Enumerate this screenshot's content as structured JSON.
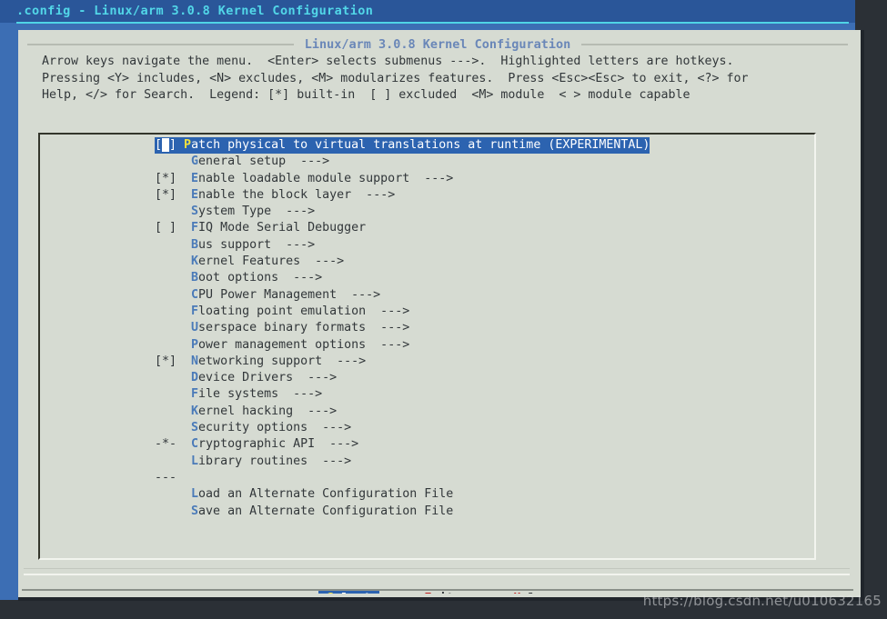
{
  "window": {
    "titlebar_text": ".config - Linux/arm 3.0.8 Kernel Configuration"
  },
  "dialog": {
    "title": "Linux/arm 3.0.8 Kernel Configuration",
    "help_lines": [
      "Arrow keys navigate the menu.  <Enter> selects submenus --->.  Highlighted letters are hotkeys.",
      "Pressing <Y> includes, <N> excludes, <M> modularizes features.  Press <Esc><Esc> to exit, <?> for",
      "Help, </> for Search.  Legend: [*] built-in  [ ] excluded  <M> module  < > module capable"
    ]
  },
  "menu": {
    "items": [
      {
        "mark": "[ ]",
        "hot": "P",
        "rest": "atch physical to virtual translations at runtime (EXPERIMENTAL)",
        "arrow": "",
        "selected": true
      },
      {
        "mark": "",
        "hot": "G",
        "rest": "eneral setup",
        "arrow": "  --->",
        "selected": false
      },
      {
        "mark": "[*]",
        "hot": "E",
        "rest": "nable loadable module support",
        "arrow": "  --->",
        "selected": false
      },
      {
        "mark": "[*]",
        "hot": "E",
        "rest": "nable the block layer",
        "arrow": "  --->",
        "selected": false
      },
      {
        "mark": "",
        "hot": "S",
        "rest": "ystem Type",
        "arrow": "  --->",
        "selected": false
      },
      {
        "mark": "[ ]",
        "hot": "F",
        "rest": "IQ Mode Serial Debugger",
        "arrow": "",
        "selected": false
      },
      {
        "mark": "",
        "hot": "B",
        "rest": "us support",
        "arrow": "  --->",
        "selected": false
      },
      {
        "mark": "",
        "hot": "K",
        "rest": "ernel Features",
        "arrow": "  --->",
        "selected": false
      },
      {
        "mark": "",
        "hot": "B",
        "rest": "oot options",
        "arrow": "  --->",
        "selected": false
      },
      {
        "mark": "",
        "hot": "C",
        "rest": "PU Power Management",
        "arrow": "  --->",
        "selected": false
      },
      {
        "mark": "",
        "hot": "F",
        "rest": "loating point emulation",
        "arrow": "  --->",
        "selected": false
      },
      {
        "mark": "",
        "hot": "U",
        "rest": "serspace binary formats",
        "arrow": "  --->",
        "selected": false
      },
      {
        "mark": "",
        "hot": "P",
        "rest": "ower management options",
        "arrow": "  --->",
        "selected": false
      },
      {
        "mark": "[*]",
        "hot": "N",
        "rest": "etworking support",
        "arrow": "  --->",
        "selected": false
      },
      {
        "mark": "",
        "hot": "D",
        "rest": "evice Drivers",
        "arrow": "  --->",
        "selected": false
      },
      {
        "mark": "",
        "hot": "F",
        "rest": "ile systems",
        "arrow": "  --->",
        "selected": false
      },
      {
        "mark": "",
        "hot": "K",
        "rest": "ernel hacking",
        "arrow": "  --->",
        "selected": false
      },
      {
        "mark": "",
        "hot": "S",
        "rest": "ecurity options",
        "arrow": "  --->",
        "selected": false
      },
      {
        "mark": "-*-",
        "hot": "C",
        "rest": "ryptographic API",
        "arrow": "  --->",
        "selected": false
      },
      {
        "mark": "",
        "hot": "L",
        "rest": "ibrary routines",
        "arrow": "  --->",
        "selected": false
      },
      {
        "mark": "---",
        "hot": "",
        "rest": "",
        "arrow": "",
        "selected": false,
        "separator": true
      },
      {
        "mark": "",
        "hot": "L",
        "rest": "oad an Alternate Configuration File",
        "arrow": "",
        "selected": false
      },
      {
        "mark": "",
        "hot": "S",
        "rest": "ave an Alternate Configuration File",
        "arrow": "",
        "selected": false
      }
    ]
  },
  "buttons": [
    {
      "pre": "<",
      "hot": "S",
      "post": "elect>",
      "primary": true
    },
    {
      "pre": "< ",
      "hot": "E",
      "post": "xit >",
      "primary": false
    },
    {
      "pre": "< ",
      "hot": "H",
      "post": "elp >",
      "primary": false
    }
  ],
  "watermark": {
    "text": "https://blog.csdn.net/u010632165"
  },
  "colors": {
    "titlebar_bg": "#2a5699",
    "titlebar_text": "#52d7e8",
    "app_bg": "#3c6eb4",
    "desktop_bg": "#2b3036",
    "dialog_bg": "#d6dbd2",
    "highlight_bg": "#2c63b0",
    "hotkey": "#4a7ab8",
    "hotkey_selected": "#f0e040",
    "button_hotkey": "#c02020",
    "dialog_title": "#6a87b8",
    "text": "#32373a"
  }
}
